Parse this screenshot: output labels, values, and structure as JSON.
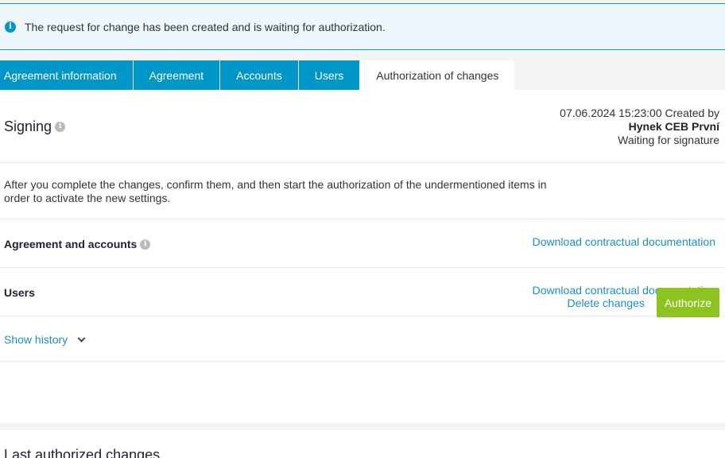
{
  "banner": {
    "icon": "info-icon",
    "text": "The request for change has been created and is waiting for authorization."
  },
  "tabs": [
    {
      "label": "Agreement information",
      "active": false
    },
    {
      "label": "Agreement",
      "active": false
    },
    {
      "label": "Accounts",
      "active": false
    },
    {
      "label": "Users",
      "active": false
    },
    {
      "label": "Authorization of changes",
      "active": true
    }
  ],
  "signing": {
    "title": "Signing",
    "created_line": "07.06.2024 15:23:00 Created by",
    "creator": "Hynek CEB První",
    "status": "Waiting for signature"
  },
  "instructions": "After you complete the changes, confirm them, and then start the authorization of the undermentioned items in order to activate the new settings.",
  "items": [
    {
      "label": "Agreement and accounts",
      "link": "Download contractual documentation"
    },
    {
      "label": "Users",
      "link": "Download contractual documentation"
    }
  ],
  "history": {
    "label": "Show history"
  },
  "actions": {
    "delete": "Delete changes",
    "authorize": "Authorize"
  },
  "last_changes": {
    "title": "Last authorized changes"
  },
  "colors": {
    "accent": "#0096c8",
    "link": "#1a8fc2",
    "authorize": "#8dc21f",
    "banner_bg": "#eef7fc"
  }
}
